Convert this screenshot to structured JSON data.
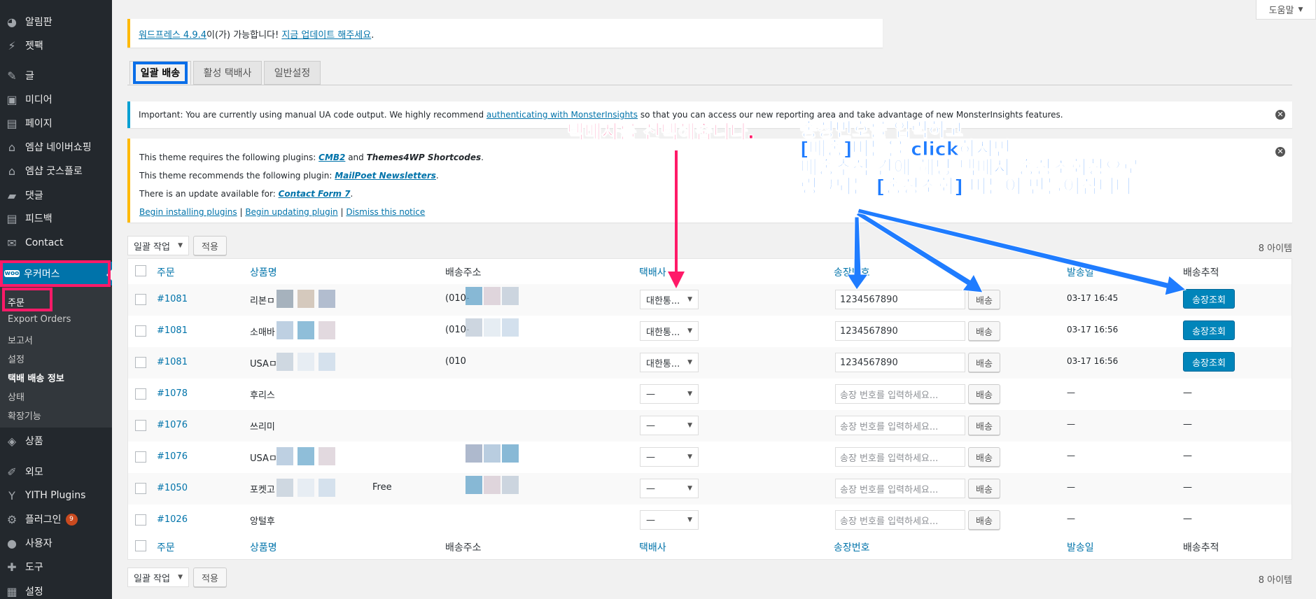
{
  "sidebar": {
    "items": [
      {
        "label": "알림판",
        "icon": "dashboard-icon",
        "glyph": "◕"
      },
      {
        "label": "젯팩",
        "icon": "jetpack-icon",
        "glyph": "⚡"
      },
      {
        "label": "글",
        "icon": "pin-icon",
        "glyph": "✎"
      },
      {
        "label": "미디어",
        "icon": "media-icon",
        "glyph": "▣"
      },
      {
        "label": "페이지",
        "icon": "page-icon",
        "glyph": "▤"
      },
      {
        "label": "엠샵 네이버쇼핑",
        "icon": "store-icon",
        "glyph": "⌂"
      },
      {
        "label": "엠샵 굿스플로",
        "icon": "store-icon",
        "glyph": "⌂"
      },
      {
        "label": "댓글",
        "icon": "comment-icon",
        "glyph": "▰"
      },
      {
        "label": "피드백",
        "icon": "feedback-icon",
        "glyph": "▤"
      },
      {
        "label": "Contact",
        "icon": "mail-icon",
        "glyph": "✉"
      },
      {
        "label": "우커머스",
        "icon": "woo-icon",
        "glyph": "woo"
      },
      {
        "label": "상품",
        "icon": "product-icon",
        "glyph": "◈"
      },
      {
        "label": "외모",
        "icon": "appearance-icon",
        "glyph": "✐"
      },
      {
        "label": "YITH Plugins",
        "icon": "yith-icon",
        "glyph": "Y"
      },
      {
        "label": "플러그인",
        "icon": "plugin-icon",
        "glyph": "⚙",
        "badge": "9"
      },
      {
        "label": "사용자",
        "icon": "user-icon",
        "glyph": "●"
      },
      {
        "label": "도구",
        "icon": "tools-icon",
        "glyph": "✚"
      },
      {
        "label": "설정",
        "icon": "settings-icon",
        "glyph": "▦"
      }
    ],
    "submenu": [
      "주문",
      "Export Orders",
      "보고서",
      "설정",
      "택배 배송 정보",
      "상태",
      "확장기능"
    ]
  },
  "help_tab": {
    "label": "도움말"
  },
  "update_notice": {
    "link1": "워드프레스 4.9.4",
    "text1": "이(가) 가능합니다! ",
    "link2": "지금 업데이트 해주세요",
    "text2": "."
  },
  "tabs": [
    "일괄 배송",
    "활성 택배사",
    "일반설정"
  ],
  "mi_notice": {
    "text1": "Important: You are currently using manual UA code output. We highly recommend ",
    "link": "authenticating with MonsterInsights",
    "text2": " so that you can access our new reporting area and take advantage of new MonsterInsights features."
  },
  "theme_notice": {
    "line1_a": "This theme requires the following plugins: ",
    "line1_link": "CMB2",
    "line1_b": " and ",
    "line1_c": "Themes4WP Shortcodes",
    "line1_d": ".",
    "line2_a": "This theme recommends the following plugin: ",
    "line2_link": "MailPoet Newsletters",
    "line2_d": ".",
    "line3_a": "There is an update available for: ",
    "line3_link": "Contact Form 7",
    "line3_d": ".",
    "links": [
      "Begin installing plugins",
      "Begin updating plugin",
      "Dismiss this notice"
    ],
    "sep": " | "
  },
  "bulk": {
    "select": "일괄 작업",
    "apply": "적용",
    "count": "8 아이템"
  },
  "table": {
    "headers": [
      "주문",
      "상품명",
      "배송주소",
      "택배사",
      "송장번호",
      "발송일",
      "배송추적"
    ],
    "send_label": "배송",
    "track_label": "송장조회",
    "placeholder": "송장 번호를 입력하세요...",
    "rows": [
      {
        "order": "#1081",
        "product": "리본ㅁ",
        "address": "(010-",
        "courier": "대한통...",
        "tracking": "1234567890",
        "date": "03-17 16:45",
        "track": true
      },
      {
        "order": "#1081",
        "product": "소매바",
        "address": "(010-",
        "courier": "대한통...",
        "tracking": "1234567890",
        "date": "03-17 16:56",
        "track": true
      },
      {
        "order": "#1081",
        "product": "USAㅁ",
        "address": "(010",
        "courier": "대한통...",
        "tracking": "1234567890",
        "date": "03-17 16:56",
        "track": true
      },
      {
        "order": "#1078",
        "product": "후리스",
        "address": "",
        "courier": "—",
        "tracking": "",
        "date": "—",
        "track": false,
        "dash": "—"
      },
      {
        "order": "#1076",
        "product": "쓰리미",
        "address": "",
        "courier": "—",
        "tracking": "",
        "date": "—",
        "track": false,
        "dash": "—"
      },
      {
        "order": "#1076",
        "product": "USAㅁ",
        "address": "",
        "courier": "—",
        "tracking": "",
        "date": "—",
        "track": false,
        "dash": "—"
      },
      {
        "order": "#1050",
        "product": "포켓고",
        "address": "",
        "extra": "Free",
        "courier": "—",
        "tracking": "",
        "date": "—",
        "track": false,
        "dash": "—"
      },
      {
        "order": "#1026",
        "product": "앙털후",
        "address": "",
        "courier": "—",
        "tracking": "",
        "date": "—",
        "track": false,
        "dash": "—"
      }
    ]
  },
  "annotations": {
    "pink": "택배사를 선택해줍니다.",
    "blue": [
      "송장번호를 입력하고",
      "[배송]버튼을 click하시면",
      "배송추적 칸에 해당 택배사 송장조회창으로",
      "링크되는 [송장조회] 버튼이 만들어집니다"
    ]
  },
  "colors": {
    "accent": "#0073aa",
    "annot_pink": "#ff1a68",
    "annot_blue": "#1f7cff",
    "sidebar": "#23282d"
  }
}
